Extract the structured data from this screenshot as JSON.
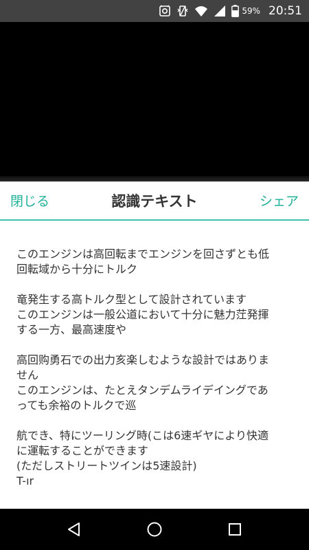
{
  "status_bar": {
    "battery_percent": "59%",
    "time": "20:51",
    "icons": [
      "notification-icon",
      "vibrate-icon",
      "wifi-icon",
      "signal-icon",
      "battery-icon"
    ]
  },
  "sheet": {
    "close_label": "閉じる",
    "title": "認識テキスト",
    "share_label": "シェア",
    "paragraphs": [
      "このエンジンは高回転までエンジンを回さずとも低\n回転域から十分にトルク",
      "竜発生する高トルク型として設計されています\nこのエンジンは一般公道において十分に魅力茳発揮\nする一方、最高速度や",
      "高回购勇石での出力亥楽しむような設計ではありま\nせん\nこのエンジンは、たとえタンデムライデイングであ\nっても余裕のトルクで巡",
      "航でき、特にツーリング時(こは6速ギヤにより快適\nに運転することができます\n(ただしストリートツインは5速設計)\nT-ır"
    ],
    "accent_color": "#1fb199"
  },
  "nav_bar": {
    "icons": [
      "back-icon",
      "home-icon",
      "recents-icon"
    ]
  }
}
